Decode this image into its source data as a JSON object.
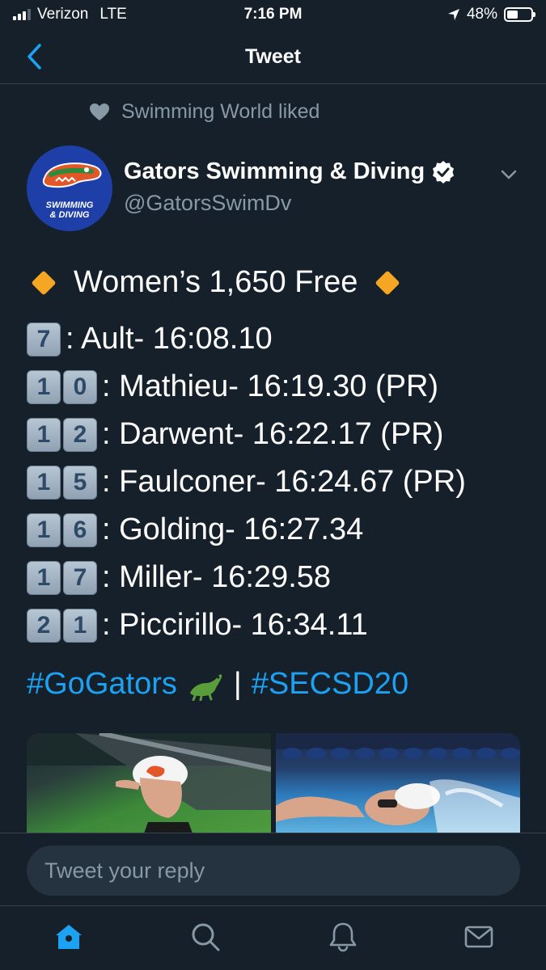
{
  "status_bar": {
    "carrier": "Verizon",
    "network": "LTE",
    "time": "7:16 PM",
    "battery_percent": "48%",
    "battery_level": 0.48
  },
  "nav": {
    "title": "Tweet",
    "back_icon": "chevron-left-icon"
  },
  "social_context": {
    "icon": "heart-icon",
    "text": "Swimming World liked"
  },
  "author": {
    "display_name": "Gators Swimming & Diving",
    "handle": "@GatorsSwimDv",
    "verified": true,
    "avatar_text_line1": "SWIMMING",
    "avatar_text_line2": "& DIVING",
    "avatar_color": "#1f3fa8"
  },
  "tweet": {
    "title": "Women’s 1,650 Free",
    "results": [
      {
        "place": "7",
        "text": ": Ault- 16:08.10"
      },
      {
        "place": "10",
        "text": ": Mathieu- 16:19.30 (PR)"
      },
      {
        "place": "12",
        "text": ": Darwent- 16:22.17 (PR)"
      },
      {
        "place": "15",
        "text": ": Faulconer- 16:24.67 (PR)"
      },
      {
        "place": "16",
        "text": ": Golding- 16:27.34"
      },
      {
        "place": "17",
        "text": ": Miller- 16:29.58"
      },
      {
        "place": "21",
        "text": ": Piccirillo- 16:34.11"
      }
    ],
    "hashtag_1": "#GoGators",
    "separator": "|",
    "hashtag_2": "#SECSD20"
  },
  "reply": {
    "placeholder": "Tweet your reply"
  },
  "tabs": [
    {
      "name": "home-icon",
      "active": true
    },
    {
      "name": "search-icon",
      "active": false
    },
    {
      "name": "bell-icon",
      "active": false
    },
    {
      "name": "mail-icon",
      "active": false
    }
  ],
  "colors": {
    "background": "#15202b",
    "accent": "#1da1f2",
    "secondary_text": "#8899a6",
    "divider": "#38444d"
  }
}
